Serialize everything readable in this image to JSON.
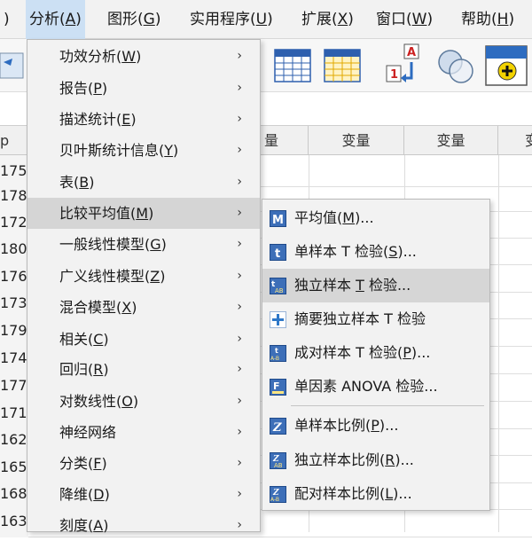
{
  "menubar": {
    "items": [
      {
        "pre": ")",
        "label": "",
        "key": ""
      },
      {
        "pre": "分析(",
        "key": "A",
        "post": ")"
      },
      {
        "pre": "图形(",
        "key": "G",
        "post": ")"
      },
      {
        "pre": "实用程序(",
        "key": "U",
        "post": ")"
      },
      {
        "pre": "扩展(",
        "key": "X",
        "post": ")"
      },
      {
        "pre": "窗口(",
        "key": "W",
        "post": ")"
      },
      {
        "pre": "帮助(",
        "key": "H",
        "post": ")"
      }
    ]
  },
  "toolbar": {
    "icons": [
      "table-grid-icon",
      "table-highlight-icon",
      "value-labels-icon",
      "venn-circles-icon",
      "add-variable-icon"
    ]
  },
  "grid": {
    "columns": [
      "量",
      "变量",
      "变量",
      "变"
    ],
    "row_header_partial": "p",
    "rows": [
      "175",
      "178",
      "172",
      "180",
      "176",
      "173",
      "179",
      "174",
      "177",
      "171",
      "162",
      "165",
      "168",
      "163"
    ]
  },
  "analyze_menu": {
    "items": [
      {
        "pre": "功效分析(",
        "key": "W",
        "post": ")"
      },
      {
        "pre": "报告(",
        "key": "P",
        "post": ")"
      },
      {
        "pre": "描述统计(",
        "key": "E",
        "post": ")"
      },
      {
        "pre": "贝叶斯统计信息(",
        "key": "Y",
        "post": ")"
      },
      {
        "pre": "表(",
        "key": "B",
        "post": ")"
      },
      {
        "pre": "比较平均值(",
        "key": "M",
        "post": ")"
      },
      {
        "pre": "一般线性模型(",
        "key": "G",
        "post": ")"
      },
      {
        "pre": "广义线性模型(",
        "key": "Z",
        "post": ")"
      },
      {
        "pre": "混合模型(",
        "key": "X",
        "post": ")"
      },
      {
        "pre": "相关(",
        "key": "C",
        "post": ")"
      },
      {
        "pre": "回归(",
        "key": "R",
        "post": ")"
      },
      {
        "pre": "对数线性(",
        "key": "O",
        "post": ")"
      },
      {
        "pre": "神经网络",
        "key": "",
        "post": ""
      },
      {
        "pre": "分类(",
        "key": "F",
        "post": ")"
      },
      {
        "pre": "降维(",
        "key": "D",
        "post": ")"
      },
      {
        "pre": "刻度(",
        "key": "A",
        "post": ")"
      }
    ],
    "arrow": "›"
  },
  "compare_means_submenu": {
    "items": [
      {
        "pre": "平均值(",
        "key": "M",
        "post": ")...",
        "icon": "means-icon",
        "icon_color": "#3d6fb8",
        "glyph": "M"
      },
      {
        "pre": "单样本 T 检验(",
        "key": "S",
        "post": ")...",
        "icon": "one-sample-t-icon",
        "icon_color": "#3d6fb8",
        "glyph": "t"
      },
      {
        "pre": "独立样本 ",
        "key": "T",
        "post": " 检验...",
        "icon": "independent-samples-t-icon",
        "icon_color": "#3d6fb8",
        "glyph": "t"
      },
      {
        "pre": "摘要独立样本 T 检验",
        "key": "",
        "post": "",
        "icon": "summary-t-icon",
        "icon_color": "#2f78c8",
        "glyph": "+"
      },
      {
        "pre": "成对样本 T 检验(",
        "key": "P",
        "post": ")...",
        "icon": "paired-samples-t-icon",
        "icon_color": "#3d6fb8",
        "glyph": "t"
      },
      {
        "pre": "单因素 ANOVA 检验...",
        "key": "",
        "post": "",
        "icon": "one-way-anova-icon",
        "icon_color": "#3d6fb8",
        "glyph": "F"
      },
      {
        "pre": "单样本比例(",
        "key": "P",
        "post": ")...",
        "icon": "one-sample-proportion-icon",
        "icon_color": "#3d6fb8",
        "glyph": "Z"
      },
      {
        "pre": "独立样本比例(",
        "key": "R",
        "post": ")...",
        "icon": "independent-proportions-icon",
        "icon_color": "#3d6fb8",
        "glyph": "Z"
      },
      {
        "pre": "配对样本比例(",
        "key": "L",
        "post": ")...",
        "icon": "paired-proportions-icon",
        "icon_color": "#3d6fb8",
        "glyph": "Z"
      }
    ]
  },
  "colors": {
    "menu_bg": "#f2f2f2",
    "highlight": "#d5d5d5",
    "menubar_active": "#cce0f4",
    "icon_blue": "#3d6fb8"
  }
}
